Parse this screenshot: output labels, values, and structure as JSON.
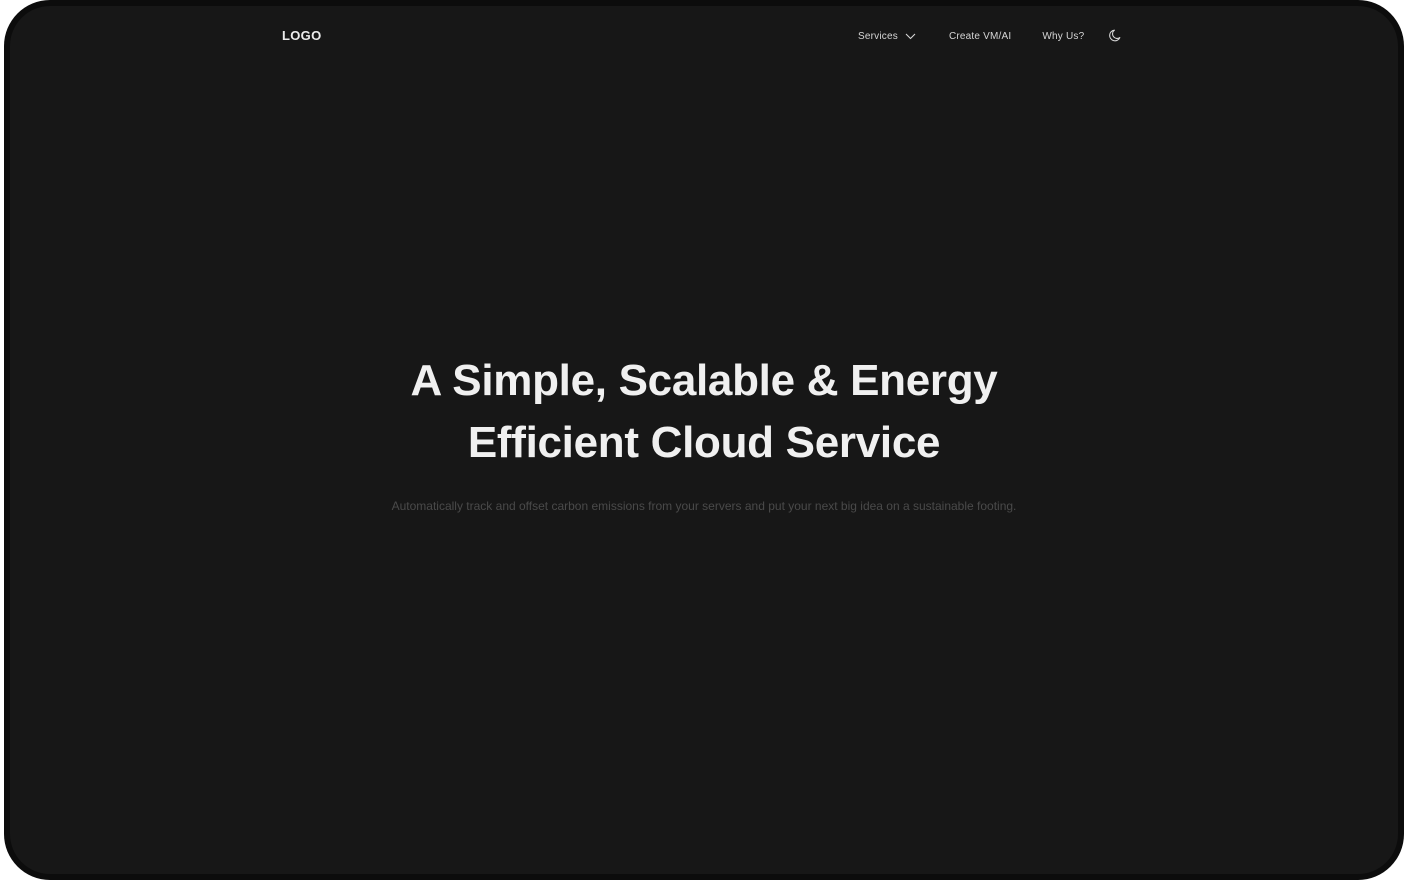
{
  "nav": {
    "logo": "LOGO",
    "items": [
      {
        "label": "Services",
        "has_dropdown": true
      },
      {
        "label": "Create VM/AI"
      },
      {
        "label": "Why Us?"
      }
    ],
    "theme_icon": "moon-icon"
  },
  "hero": {
    "title": "A Simple, Scalable & Energy Efficient Cloud Service",
    "subtitle": "Automatically track and offset carbon emissions from your servers and put your next big idea on a sustainable footing."
  },
  "colors": {
    "background": "#171717",
    "frame": "#0c0c0c",
    "text_primary": "#f0f0f0",
    "text_muted": "#4a4a4a"
  }
}
